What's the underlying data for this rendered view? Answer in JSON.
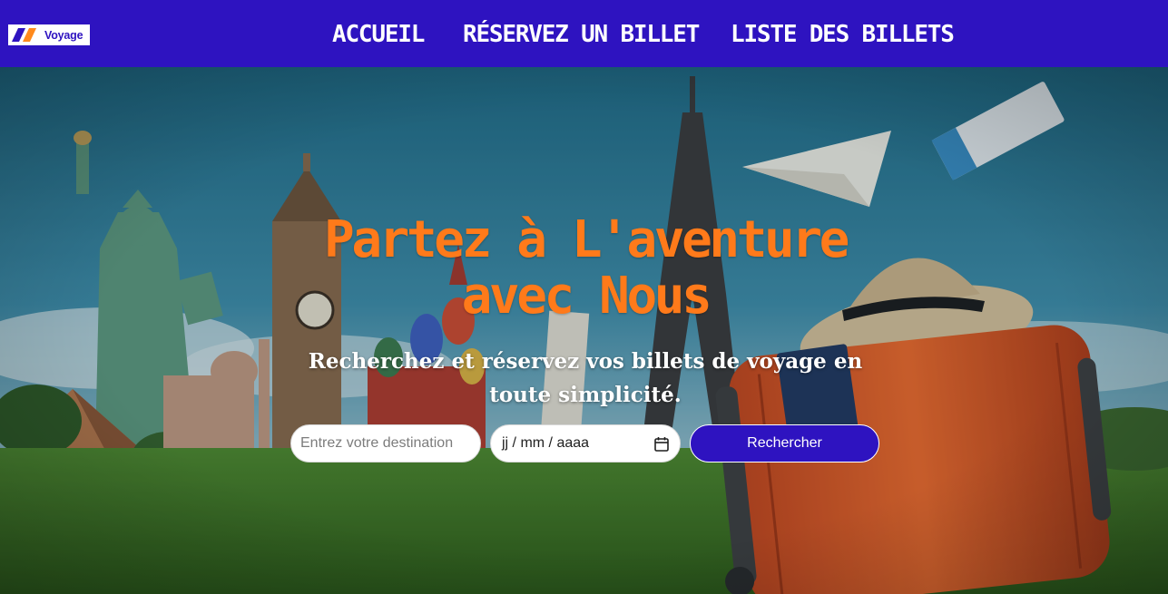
{
  "brand": {
    "logo_text": "Voyage"
  },
  "nav": {
    "items": [
      {
        "label": "ACCUEIL"
      },
      {
        "label": "RÉSERVEZ UN BILLET"
      },
      {
        "label": "LISTE DES BILLETS"
      }
    ]
  },
  "hero": {
    "title": "Partez à L'aventure avec Nous",
    "subtitle": "Recherchez et réservez vos billets de voyage en toute simplicité."
  },
  "search": {
    "destination_placeholder": "Entrez votre destination",
    "date_placeholder": "jj / mm / aaaa",
    "button_label": "Rechercher"
  },
  "colors": {
    "header_bg": "#2e13c0",
    "accent_orange": "#ff7a1a",
    "button_bg": "#2e13c0",
    "text_white": "#ffffff"
  },
  "icons": {
    "logo": "voyage-logo-icon",
    "date_picker": "calendar-icon"
  }
}
